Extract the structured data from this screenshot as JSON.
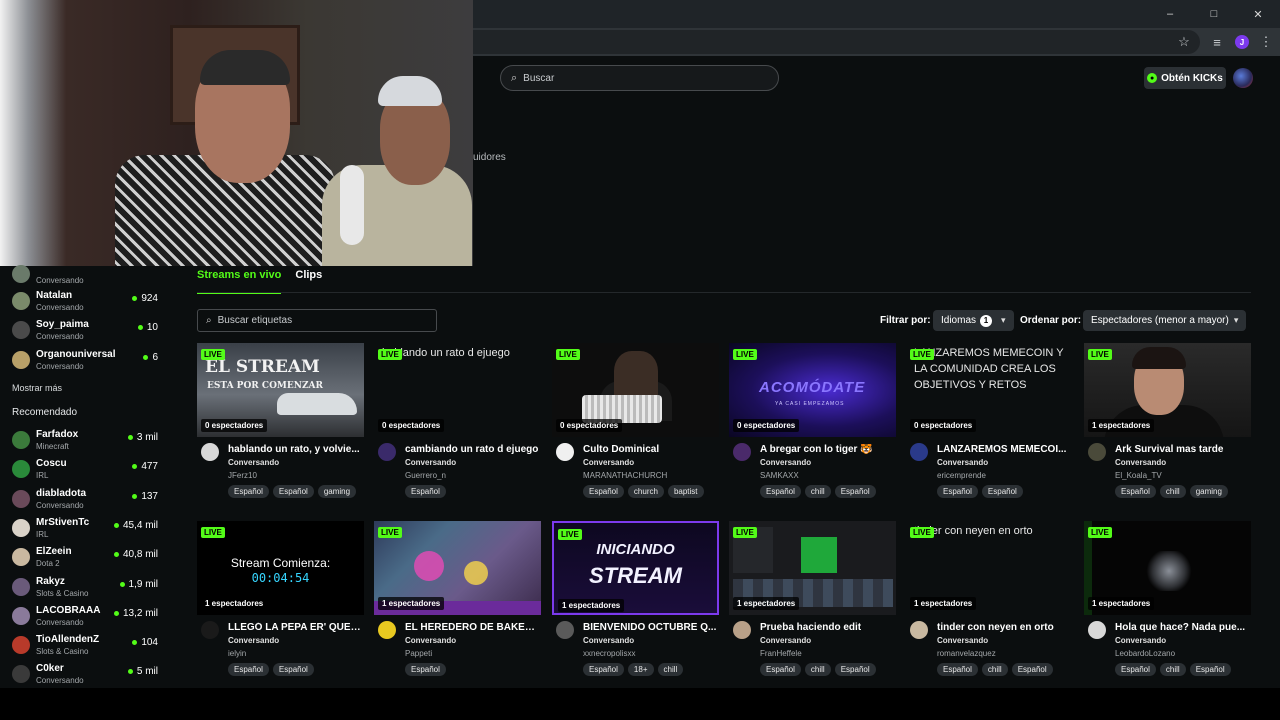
{
  "browser": {
    "window_controls": [
      "–",
      "□",
      "✕"
    ],
    "profile_initial": "J"
  },
  "header": {
    "search_placeholder": "Buscar",
    "kicks_button": "Obtén KICKs"
  },
  "followers_fragment": "uidores",
  "sidebar": {
    "following": [
      {
        "name": "Natalan",
        "category": "Conversando",
        "viewers": "924",
        "color": "#7a8a6a"
      },
      {
        "name": "Soy_paima",
        "category": "Conversando",
        "viewers": "10",
        "color": "#4a4a4a"
      },
      {
        "name": "Organouniversal",
        "category": "Conversando",
        "viewers": "6",
        "color": "#b8a068"
      }
    ],
    "partial_top_category": "Conversando",
    "show_more": "Mostrar más",
    "recommended_heading": "Recomendado",
    "recommended": [
      {
        "name": "Farfadox",
        "category": "Minecraft",
        "viewers": "3 mil",
        "color": "#3b7a3b"
      },
      {
        "name": "Coscu",
        "category": "IRL",
        "viewers": "477",
        "color": "#2a8a3a"
      },
      {
        "name": "diabladota",
        "category": "Conversando",
        "viewers": "137",
        "color": "#6a4a5a"
      },
      {
        "name": "MrStivenTc",
        "category": "IRL",
        "viewers": "45,4 mil",
        "color": "#d9d2c8"
      },
      {
        "name": "ElZeein",
        "category": "Dota 2",
        "viewers": "40,8 mil",
        "color": "#c9b8a0"
      },
      {
        "name": "Rakyz",
        "category": "Slots & Casino",
        "viewers": "1,9 mil",
        "color": "#6a5a7a"
      },
      {
        "name": "LACOBRAAA",
        "category": "Conversando",
        "viewers": "13,2 mil",
        "color": "#8a7a9a"
      },
      {
        "name": "TioAllendenZ",
        "category": "Slots & Casino",
        "viewers": "104",
        "color": "#b83a2a"
      },
      {
        "name": "C0ker",
        "category": "Conversando",
        "viewers": "5 mil",
        "color": "#3a3a3a"
      }
    ]
  },
  "tabs": [
    {
      "label": "Streams en vivo"
    },
    {
      "label": "Clips"
    }
  ],
  "tag_search_placeholder": "Buscar etiquetas",
  "filters": {
    "filter_label": "Filtrar por:",
    "languages_label": "Idiomas",
    "languages_count": "1",
    "sort_label": "Ordenar por:",
    "sort_value": "Espectadores (menor a mayor)"
  },
  "live_label": "LIVE",
  "streams": [
    {
      "title": "hablando un rato, y volvie...",
      "category": "Conversando",
      "channel": "JFerz10",
      "viewers": "0 espectadores",
      "tags": [
        "Español",
        "Español",
        "gaming"
      ],
      "art": "stream1",
      "avatar_color": "#d8d8d8"
    },
    {
      "title": "cambiando un rato d ejuego",
      "category": "Conversando",
      "channel": "Guerrero_n",
      "viewers": "0 espectadores",
      "tags": [
        "Español"
      ],
      "art": "broken",
      "alt": "hablando un rato d ejuego",
      "avatar_color": "#3a2a6a"
    },
    {
      "title": "Culto Dominical",
      "category": "Conversando",
      "channel": "MARANATHACHURCH",
      "viewers": "0 espectadores",
      "tags": [
        "Español",
        "church",
        "baptist"
      ],
      "art": "church",
      "avatar_color": "#f0f0f0"
    },
    {
      "title": "A bregar con lo tiger 🐯",
      "category": "Conversando",
      "channel": "SAMKAXX",
      "viewers": "0 espectadores",
      "tags": [
        "Español",
        "chill",
        "Español"
      ],
      "art": "acom",
      "avatar_color": "#4a2a6a"
    },
    {
      "title": "LANZAREMOS MEMECOI...",
      "category": "Conversando",
      "channel": "ericemprende",
      "viewers": "0 espectadores",
      "tags": [
        "Español",
        "Español"
      ],
      "art": "broken",
      "alt": "LANZAREMOS MEMECOIN Y LA COMUNIDAD CREA LOS OBJETIVOS Y RETOS",
      "avatar_color": "#2a3a8a"
    },
    {
      "title": "Ark Survival mas tarde",
      "category": "Conversando",
      "channel": "El_Koala_TV",
      "viewers": "1 espectadores",
      "tags": [
        "Español",
        "chill",
        "gaming"
      ],
      "art": "ark",
      "avatar_color": "#4a4a3a"
    },
    {
      "title": "LLEGÓ LA PEPA ER' QUES...",
      "category": "Conversando",
      "channel": "ielyin",
      "viewers": "1 espectadores",
      "tags": [
        "Español",
        "Español"
      ],
      "art": "timer",
      "avatar_color": "#1a1a1a"
    },
    {
      "title": "EL HEREDERO DE BAKER |...",
      "category": "Conversando",
      "channel": "Pappeti",
      "viewers": "1 espectadores",
      "tags": [
        "Español"
      ],
      "art": "moba",
      "avatar_color": "#e8c820"
    },
    {
      "title": "BIENVENIDO OCTUBRE Q...",
      "category": "Conversando",
      "channel": "xxnecropolisxx",
      "viewers": "1 espectadores",
      "tags": [
        "Español",
        "18+",
        "chill"
      ],
      "art": "iniciando",
      "avatar_color": "#5a5a5a"
    },
    {
      "title": "Prueba haciendo edit",
      "category": "Conversando",
      "channel": "FranHeffele",
      "viewers": "1 espectadores",
      "tags": [
        "Español",
        "chill",
        "Español"
      ],
      "art": "edit",
      "avatar_color": "#b8a088"
    },
    {
      "title": "tinder con neyen en orto",
      "category": "Conversando",
      "channel": "romanvelazquez",
      "viewers": "1 espectadores",
      "tags": [
        "Español",
        "chill",
        "Español"
      ],
      "art": "broken",
      "alt": "tinder con neyen en orto",
      "avatar_color": "#c8b8a0"
    },
    {
      "title": "Hola que hace? Nada pue...",
      "category": "Conversando",
      "channel": "LeobardoLozano",
      "viewers": "1 espectadores",
      "tags": [
        "Español",
        "chill",
        "Español"
      ],
      "art": "dark",
      "avatar_color": "#d8d8d8"
    }
  ],
  "art_text": {
    "stream1_line1": "EL STREAM",
    "stream1_line2": "ESTA POR COMENZAR",
    "acom_title": "ACOMÓDATE",
    "acom_sub": "YA CASI EMPEZAMOS",
    "timer_title": "Stream Comienza:",
    "timer_clock": "00:04:54",
    "iniciando_line1": "INICIANDO",
    "iniciando_line2": "STREAM"
  }
}
